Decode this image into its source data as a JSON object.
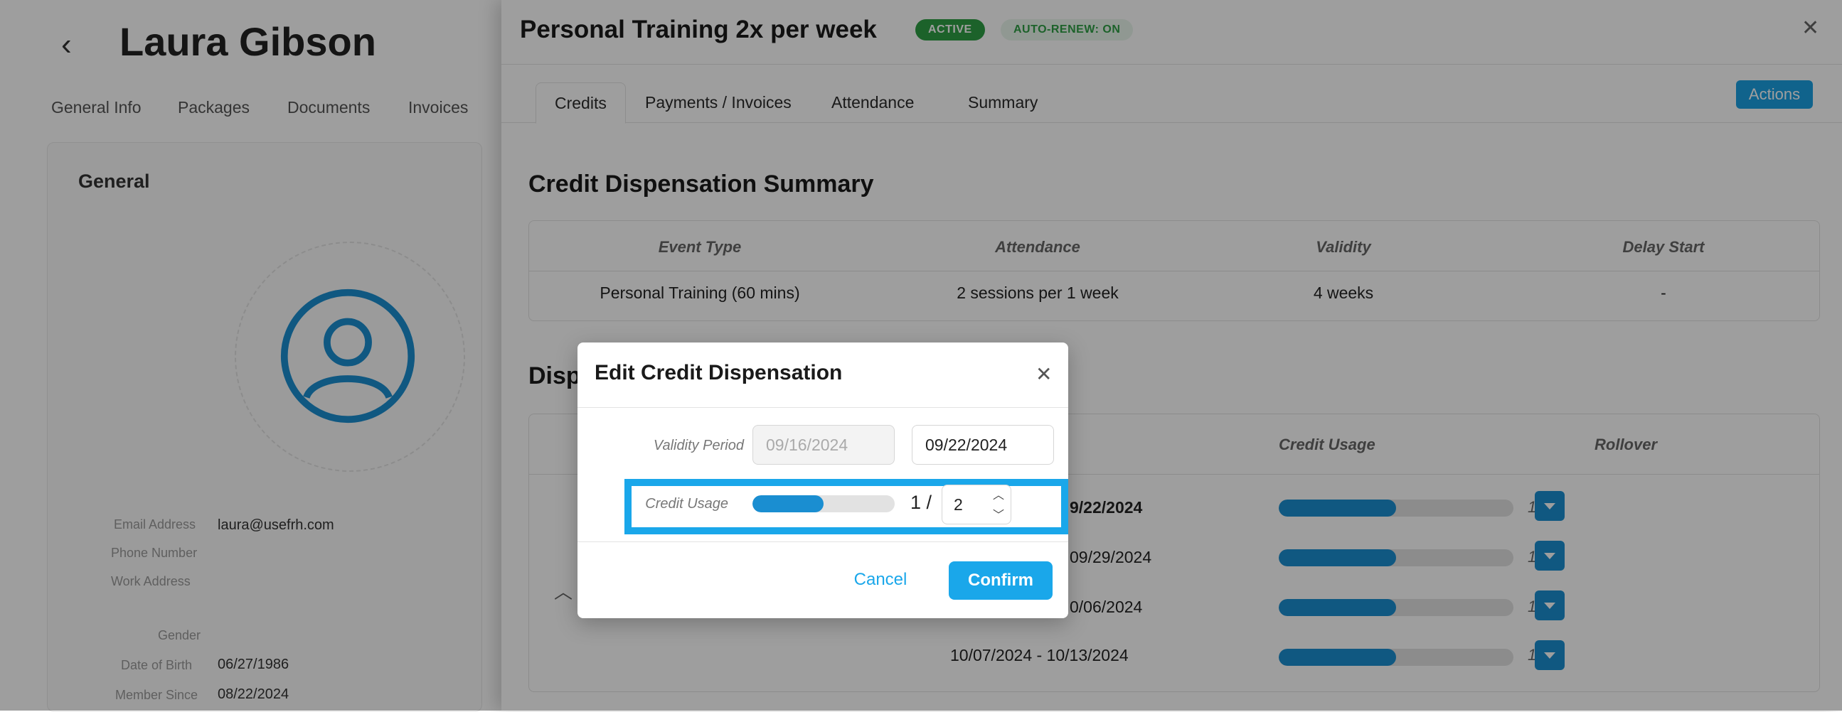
{
  "profile": {
    "back_icon": "‹",
    "name": "Laura Gibson",
    "tabs": [
      "General Info",
      "Packages",
      "Documents",
      "Invoices"
    ],
    "section_title": "General",
    "email_label": "Email Address",
    "email_value": "laura@usefrh.com",
    "phone_label": "Phone Number",
    "work_label": "Work Address",
    "gender_label": "Gender",
    "dob_label": "Date of Birth",
    "dob_value": "06/27/1986",
    "member_since_label": "Member Since",
    "member_since_value": "08/22/2024"
  },
  "drawer": {
    "title": "Personal Training 2x per week",
    "badge_active": "ACTIVE",
    "badge_renew": "AUTO-RENEW: ON",
    "close_icon": "✕",
    "tabs": [
      "Credits",
      "Payments / Invoices",
      "Attendance",
      "Summary"
    ],
    "actions_label": "Actions",
    "summary": {
      "title": "Credit Dispensation Summary",
      "headers": [
        "Event Type",
        "Attendance",
        "Validity",
        "Delay Start"
      ],
      "row": [
        "Personal Training (60 mins)",
        "2 sessions per 1 week",
        "4 weeks",
        "-"
      ]
    },
    "dispensation": {
      "title": "Disp",
      "headers": {
        "usage": "Credit Usage",
        "rollover": "Rollover"
      },
      "rows": [
        {
          "date": "9/22/2024",
          "usage": "1 / 2",
          "fraction": 0.5
        },
        {
          "date": "09/29/2024",
          "usage": "1 / 2",
          "fraction": 0.5
        },
        {
          "date": "0/06/2024",
          "usage": "1 / 2",
          "fraction": 0.5
        },
        {
          "date": "10/07/2024 - 10/13/2024",
          "usage": "1 / 2",
          "fraction": 0.5
        }
      ],
      "collapse_icon": "︿"
    }
  },
  "modal": {
    "title": "Edit Credit Dispensation",
    "close_icon": "✕",
    "validity_label": "Validity Period",
    "validity_start": "09/16/2024",
    "validity_end": "09/22/2024",
    "usage_label": "Credit Usage",
    "usage_fraction": 0.5,
    "usage_used": "1 /",
    "usage_total": "2",
    "spin_up_icon": "︿",
    "spin_down_icon": "﹀",
    "cancel_label": "Cancel",
    "confirm_label": "Confirm"
  },
  "colors": {
    "accent": "#1aa7ea",
    "progress": "#1a8ed1",
    "active_badge": "#2e9e44"
  }
}
